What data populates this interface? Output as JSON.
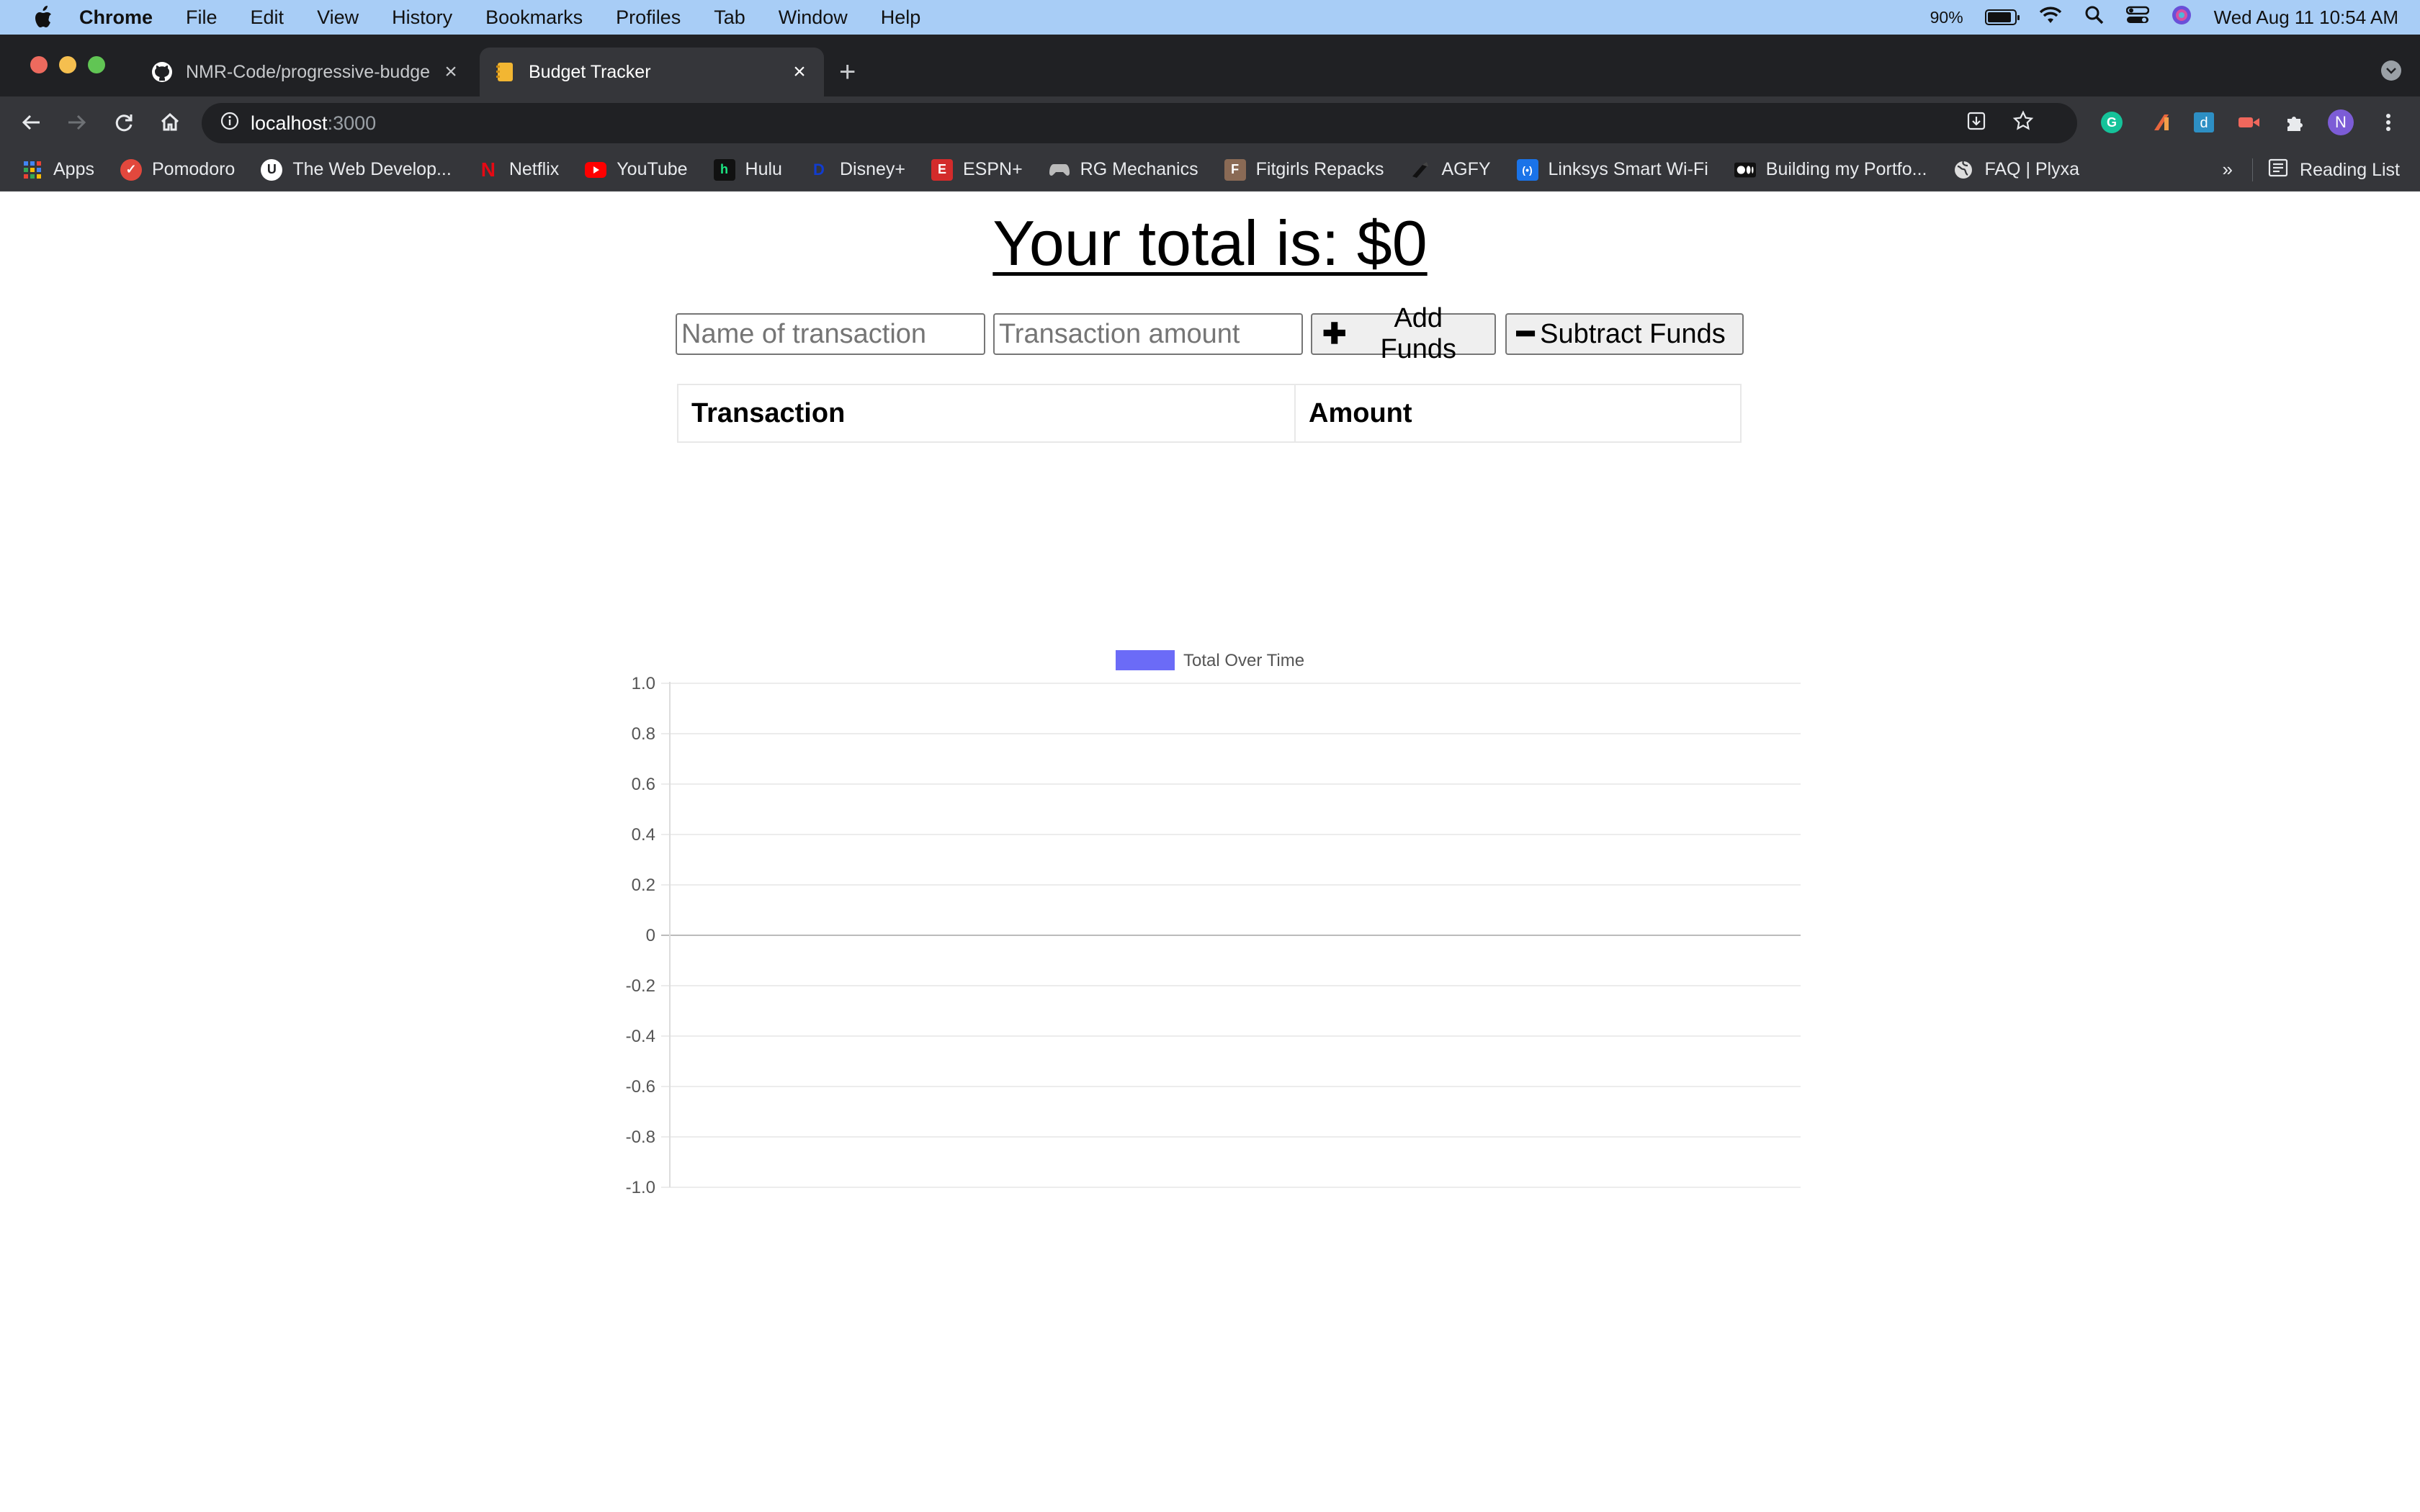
{
  "menubar": {
    "app_name": "Chrome",
    "menus": [
      "File",
      "Edit",
      "View",
      "History",
      "Bookmarks",
      "Profiles",
      "Tab",
      "Window",
      "Help"
    ],
    "battery_percent": "90%",
    "clock": "Wed Aug 11  10:54 AM"
  },
  "tabs": [
    {
      "title": "NMR-Code/progressive-budge",
      "icon": "github-icon",
      "active": false
    },
    {
      "title": "Budget Tracker",
      "icon": "notebook-icon",
      "active": true
    }
  ],
  "address_bar": {
    "host": "localhost",
    "port": ":3000"
  },
  "bookmarks": {
    "items": [
      {
        "label": "Apps",
        "icon": "apps-grid-icon",
        "color": "#4285f4"
      },
      {
        "label": "Pomodoro",
        "icon": "pomodoro-icon",
        "color": "#e2483d"
      },
      {
        "label": "The Web Develop...",
        "icon": "udemy-icon",
        "color": "#ffffff"
      },
      {
        "label": "Netflix",
        "icon": "netflix-icon",
        "color": "#e50914"
      },
      {
        "label": "YouTube",
        "icon": "youtube-icon",
        "color": "#ff0000"
      },
      {
        "label": "Hulu",
        "icon": "hulu-icon",
        "color": "#1ce783"
      },
      {
        "label": "Disney+",
        "icon": "disney-icon",
        "color": "#113ccf"
      },
      {
        "label": "ESPN+",
        "icon": "espn-icon",
        "color": "#d32b2b"
      },
      {
        "label": "RG Mechanics",
        "icon": "gamepad-icon",
        "color": "#bbbbbb"
      },
      {
        "label": "Fitgirls Repacks",
        "icon": "fitgirl-icon",
        "color": "#8a6a55"
      },
      {
        "label": "AGFY",
        "icon": "agfy-icon",
        "color": "#111111"
      },
      {
        "label": "Linksys Smart Wi-Fi",
        "icon": "linksys-icon",
        "color": "#1a73e8"
      },
      {
        "label": "Building my Portfo...",
        "icon": "medium-icon",
        "color": "#ffffff"
      },
      {
        "label": "FAQ | Plyxa",
        "icon": "globe-icon",
        "color": "#dddddd"
      }
    ],
    "more": "»",
    "reading_list": "Reading List"
  },
  "page": {
    "total_text": "Your total is: $0",
    "name_placeholder": "Name of transaction",
    "amount_placeholder": "Transaction amount",
    "add_label": "Add Funds",
    "subtract_label": "Subtract Funds",
    "table_headers": [
      "Transaction",
      "Amount"
    ]
  },
  "chart_data": {
    "type": "line",
    "series": [
      {
        "name": "Total Over Time",
        "values": [],
        "color": "#6b6bf7"
      }
    ],
    "x": [],
    "ylim": [
      -1.0,
      1.0
    ],
    "yticks": [
      "1.0",
      "0.8",
      "0.6",
      "0.4",
      "0.2",
      "0",
      "-0.2",
      "-0.4",
      "-0.6",
      "-0.8",
      "-1.0"
    ],
    "grid": true,
    "legend_position": "top"
  }
}
